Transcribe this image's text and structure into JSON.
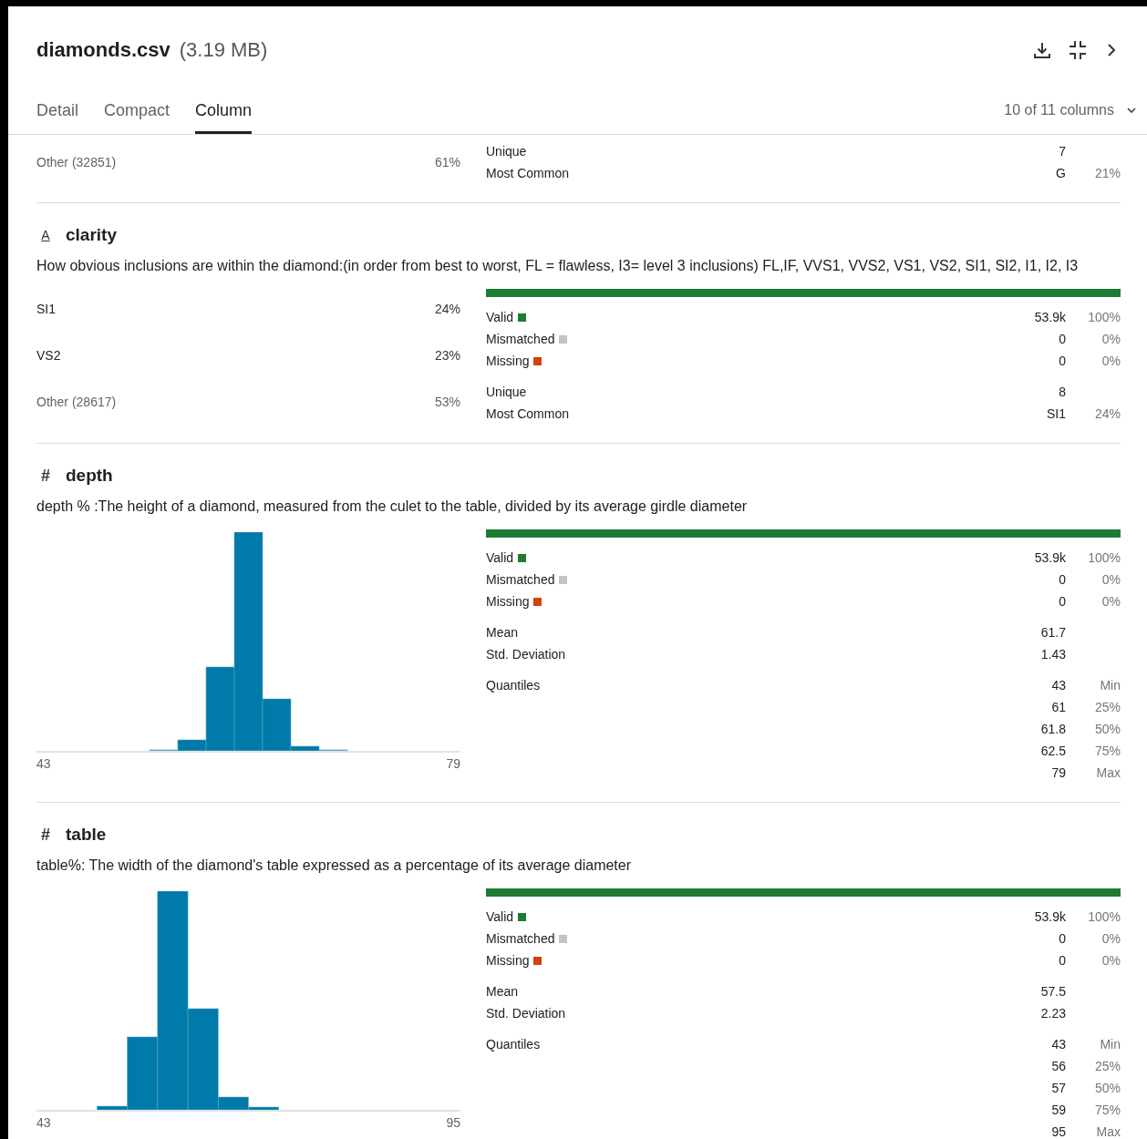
{
  "header": {
    "title": "diamonds.csv",
    "size": "(3.19 MB)"
  },
  "tabs": [
    {
      "label": "Detail",
      "selected": false
    },
    {
      "label": "Compact",
      "selected": false
    },
    {
      "label": "Column",
      "selected": true
    }
  ],
  "column_count": "10 of 11 columns",
  "sections": [
    {
      "kind": "categorical",
      "top_values": [
        {
          "label": "Other (32851)",
          "percent": "61%",
          "other": true
        }
      ],
      "stats": [
        {
          "label": "Unique",
          "value": "7"
        },
        {
          "label": "Most Common",
          "value": "G",
          "percent": "21%"
        }
      ]
    },
    {
      "kind": "categorical",
      "type_symbol": "A",
      "name": "clarity",
      "description": "How obvious inclusions are within the diamond:(in order from best to worst, FL = flawless, I3= level 3 inclusions) FL,IF, VVS1, VVS2, VS1, VS2, SI1, SI2, I1, I2, I3",
      "top_values": [
        {
          "label": "SI1",
          "percent": "24%",
          "other": false
        },
        {
          "label": "VS2",
          "percent": "23%",
          "other": false
        },
        {
          "label": "Other (28617)",
          "percent": "53%",
          "other": true
        }
      ],
      "validity": {
        "level": 1,
        "rows": [
          {
            "label": "Valid",
            "color": "#1e7b34",
            "count": "53.9k",
            "percent": "100%"
          },
          {
            "label": "Mismatched",
            "color": "#c4c4c4",
            "count": "0",
            "percent": "0%"
          },
          {
            "label": "Missing",
            "color": "#d83f0f",
            "count": "0",
            "percent": "0%"
          }
        ]
      },
      "stats": [
        {
          "label": "Unique",
          "value": "8"
        },
        {
          "label": "Most Common",
          "value": "SI1",
          "percent": "24%"
        }
      ]
    },
    {
      "kind": "numeric",
      "type_symbol": "#",
      "name": "depth",
      "description": "depth % :The height of a diamond, measured from the culet to the table, divided by its average girdle diameter",
      "histogram": {
        "min": "43",
        "max": "79"
      },
      "validity": {
        "level": 1,
        "rows": [
          {
            "label": "Valid",
            "color": "#1e7b34",
            "count": "53.9k",
            "percent": "100%"
          },
          {
            "label": "Mismatched",
            "color": "#c4c4c4",
            "count": "0",
            "percent": "0%"
          },
          {
            "label": "Missing",
            "color": "#d83f0f",
            "count": "0",
            "percent": "0%"
          }
        ]
      },
      "stats": [
        {
          "label": "Mean",
          "value": "61.7"
        },
        {
          "label": "Std. Deviation",
          "value": "1.43"
        }
      ],
      "quantiles_label": "Quantiles",
      "quantiles": [
        {
          "value": "43",
          "label": "Min"
        },
        {
          "value": "61",
          "label": "25%"
        },
        {
          "value": "61.8",
          "label": "50%"
        },
        {
          "value": "62.5",
          "label": "75%"
        },
        {
          "value": "79",
          "label": "Max"
        }
      ]
    },
    {
      "kind": "numeric",
      "type_symbol": "#",
      "name": "table",
      "description": "table%: The width of the diamond's table expressed as a percentage of its average diameter",
      "histogram": {
        "min": "43",
        "max": "95"
      },
      "validity": {
        "level": 1,
        "rows": [
          {
            "label": "Valid",
            "color": "#1e7b34",
            "count": "53.9k",
            "percent": "100%"
          },
          {
            "label": "Mismatched",
            "color": "#c4c4c4",
            "count": "0",
            "percent": "0%"
          },
          {
            "label": "Missing",
            "color": "#d83f0f",
            "count": "0",
            "percent": "0%"
          }
        ]
      },
      "stats": [
        {
          "label": "Mean",
          "value": "57.5"
        },
        {
          "label": "Std. Deviation",
          "value": "2.23"
        }
      ],
      "quantiles_label": "Quantiles",
      "quantiles": [
        {
          "value": "43",
          "label": "Min"
        },
        {
          "value": "56",
          "label": "25%"
        },
        {
          "value": "57",
          "label": "50%"
        },
        {
          "value": "59",
          "label": "75%"
        },
        {
          "value": "95",
          "label": "Max"
        }
      ]
    }
  ]
}
